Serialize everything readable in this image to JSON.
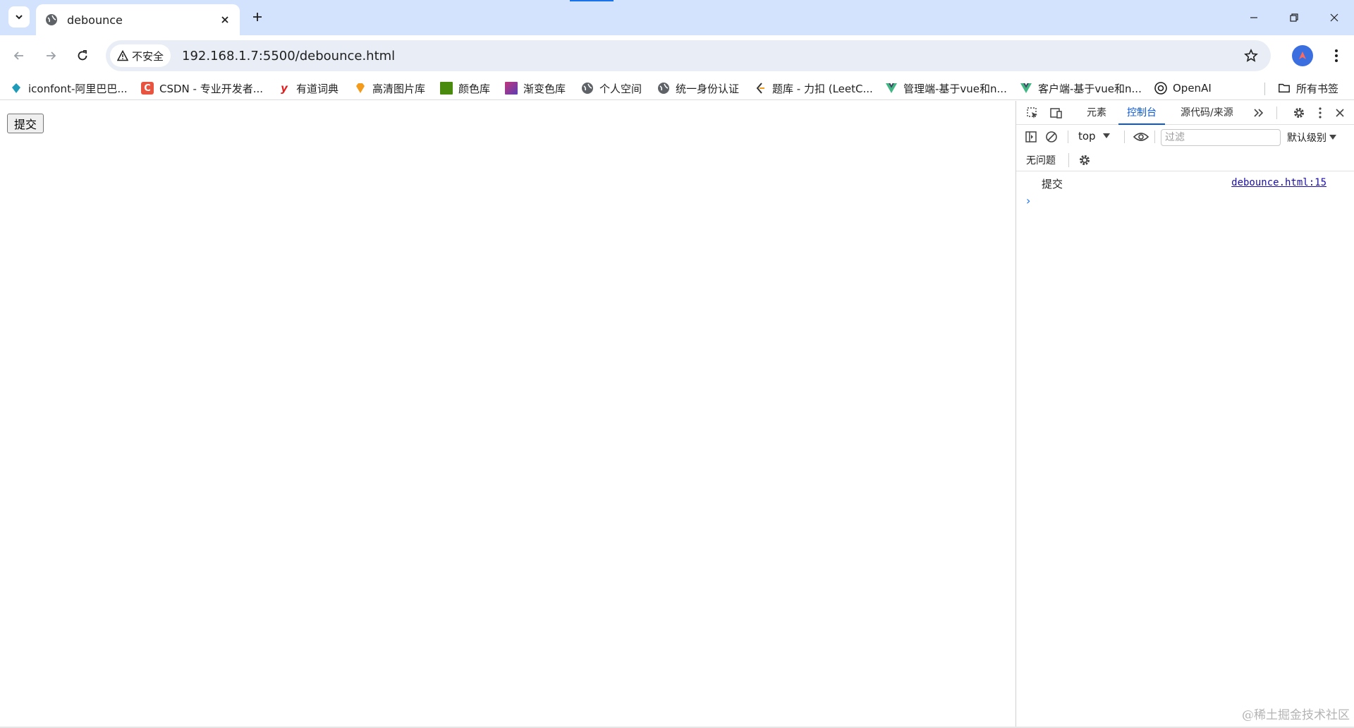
{
  "browser": {
    "tab": {
      "title": "debounce"
    },
    "omnibox": {
      "security_label": "不安全",
      "url": "192.168.1.7:5500/debounce.html"
    },
    "bookmarks": [
      {
        "label": "iconfont-阿里巴巴...",
        "icon": "iconfont-icon",
        "color": "#1d9bb8"
      },
      {
        "label": "CSDN - 专业开发者...",
        "icon": "csdn-icon",
        "color": "#e8543f"
      },
      {
        "label": "有道词典",
        "icon": "youdao-icon",
        "color": "#e02020"
      },
      {
        "label": "高清图片库",
        "icon": "gem-icon",
        "color": "#f29b1d"
      },
      {
        "label": "颜色库",
        "icon": "color-square-icon",
        "color": "#4a8a0e"
      },
      {
        "label": "渐变色库",
        "icon": "gradient-square-icon",
        "color": "#8d3ea8"
      },
      {
        "label": "个人空间",
        "icon": "globe-icon",
        "color": "#5f6368"
      },
      {
        "label": "统一身份认证",
        "icon": "globe-icon",
        "color": "#5f6368"
      },
      {
        "label": "题库 - 力扣 (LeetC...",
        "icon": "leetcode-icon",
        "color": "#333333"
      },
      {
        "label": "管理端-基于vue和n...",
        "icon": "vue-icon",
        "color": "#41b883"
      },
      {
        "label": "客户端-基于vue和n...",
        "icon": "vue-icon",
        "color": "#41b883"
      },
      {
        "label": "OpenAI",
        "icon": "openai-icon",
        "color": "#1f1f1f"
      }
    ],
    "all_bookmarks_label": "所有书签"
  },
  "page": {
    "submit_button_label": "提交"
  },
  "devtools": {
    "tabs": [
      {
        "label": "元素",
        "active": false
      },
      {
        "label": "控制台",
        "active": true
      },
      {
        "label": "源代码/来源",
        "active": false
      }
    ],
    "context": "top",
    "filter_placeholder": "过滤",
    "level_label": "默认级别",
    "issues_label": "无问题",
    "logs": [
      {
        "message": "提交",
        "source": "debounce.html:15"
      }
    ],
    "prompt_symbol": "›"
  },
  "watermark": "@稀土掘金技术社区"
}
